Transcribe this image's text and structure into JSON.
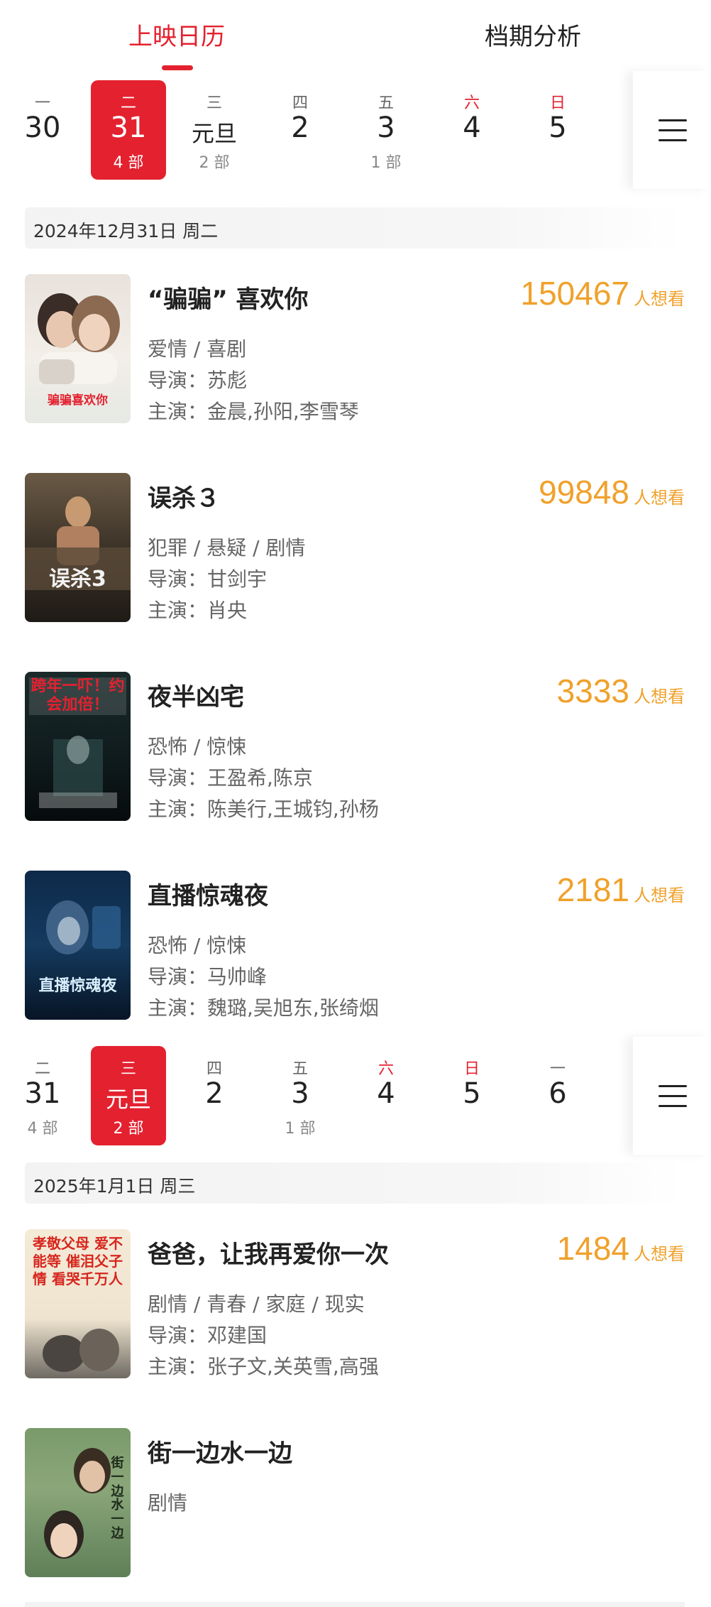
{
  "tabs": [
    {
      "label": "上映日历",
      "active": true
    },
    {
      "label": "档期分析",
      "active": false
    }
  ],
  "strip1": {
    "days": [
      {
        "weekday": "一",
        "date": "30",
        "count": "",
        "selected": false,
        "weekend": false
      },
      {
        "weekday": "二",
        "date": "31",
        "count": "4 部",
        "selected": true,
        "weekend": false
      },
      {
        "weekday": "三",
        "date": "元旦",
        "count": "2 部",
        "selected": false,
        "weekend": false
      },
      {
        "weekday": "四",
        "date": "2",
        "count": "",
        "selected": false,
        "weekend": false
      },
      {
        "weekday": "五",
        "date": "3",
        "count": "1 部",
        "selected": false,
        "weekend": false
      },
      {
        "weekday": "六",
        "date": "4",
        "count": "",
        "selected": false,
        "weekend": true
      },
      {
        "weekday": "日",
        "date": "5",
        "count": "",
        "selected": false,
        "weekend": true
      }
    ]
  },
  "section1": {
    "date_label": "2024年12月31日  周二",
    "movies": [
      {
        "title": "“骗骗” 喜欢你",
        "want": "150467",
        "want_unit": "人想看",
        "genre": "爱情 / 喜剧",
        "director_label": "导演：",
        "director": "苏彪",
        "cast_label": "主演：",
        "cast": "金晨,孙阳,李雪琴",
        "poster_text": "骗骗喜欢你"
      },
      {
        "title": "误杀３",
        "want": "99848",
        "want_unit": "人想看",
        "genre": "犯罪 / 悬疑 / 剧情",
        "director_label": "导演：",
        "director": "甘剑宇",
        "cast_label": "主演：",
        "cast": "肖央",
        "poster_text": "误杀3"
      },
      {
        "title": "夜半凶宅",
        "want": "3333",
        "want_unit": "人想看",
        "genre": "恐怖 / 惊悚",
        "director_label": "导演：",
        "director": "王盈希,陈京",
        "cast_label": "主演：",
        "cast": "陈美行,王城钧,孙杨",
        "poster_text": "跨年一吓！约会加倍！"
      },
      {
        "title": "直播惊魂夜",
        "want": "2181",
        "want_unit": "人想看",
        "genre": "恐怖 / 惊悚",
        "director_label": "导演：",
        "director": "马帅峰",
        "cast_label": "主演：",
        "cast": "魏璐,吴旭东,张绮烟",
        "poster_text": "直播惊魂夜"
      }
    ]
  },
  "strip2": {
    "days": [
      {
        "weekday": "二",
        "date": "31",
        "count": "4 部",
        "selected": false,
        "weekend": false
      },
      {
        "weekday": "三",
        "date": "元旦",
        "count": "2 部",
        "selected": true,
        "weekend": false
      },
      {
        "weekday": "四",
        "date": "2",
        "count": "",
        "selected": false,
        "weekend": false
      },
      {
        "weekday": "五",
        "date": "3",
        "count": "1 部",
        "selected": false,
        "weekend": false
      },
      {
        "weekday": "六",
        "date": "4",
        "count": "",
        "selected": false,
        "weekend": true
      },
      {
        "weekday": "日",
        "date": "5",
        "count": "",
        "selected": false,
        "weekend": true
      },
      {
        "weekday": "一",
        "date": "6",
        "count": "",
        "selected": false,
        "weekend": false
      }
    ]
  },
  "section2": {
    "date_label": "2025年1月1日  周三",
    "movies": [
      {
        "title": "爸爸，让我再爱你一次",
        "want": "1484",
        "want_unit": "人想看",
        "genre": "剧情 / 青春 / 家庭 / 现实",
        "director_label": "导演：",
        "director": "邓建国",
        "cast_label": "主演：",
        "cast": "张子文,关英雪,高强",
        "poster_text": "孝敬父母 爱不能等 催泪父子情 看哭千万人"
      },
      {
        "title": "街一边水一边",
        "want": "",
        "want_unit": "",
        "genre": "剧情",
        "director_label": "",
        "director": "",
        "cast_label": "",
        "cast": "",
        "poster_text": "街一边水一边"
      }
    ]
  },
  "colors": {
    "accent": "#e4212f",
    "want": "#f0a12b"
  }
}
